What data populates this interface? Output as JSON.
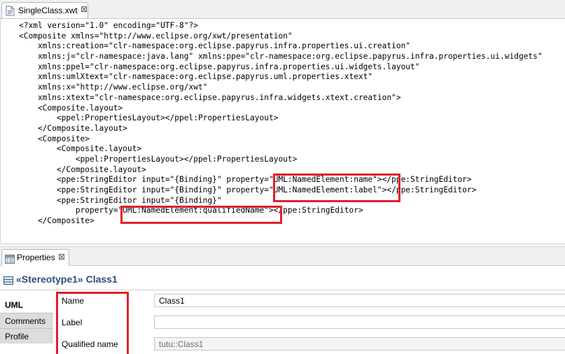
{
  "editor_tab": {
    "title": "SingleClass.xwt",
    "close": "⊠"
  },
  "code_lines": [
    "<?xml version=\"1.0\" encoding=\"UTF-8\"?>",
    "<Composite xmlns=\"http://www.eclipse.org/xwt/presentation\"",
    "    xmlns:creation=\"clr-namespace:org.eclipse.papyrus.infra.properties.ui.creation\"",
    "    xmlns:j=\"clr-namespace:java.lang\" xmlns:ppe=\"clr-namespace:org.eclipse.papyrus.infra.properties.ui.widgets\"",
    "    xmlns:ppel=\"clr-namespace:org.eclipse.papyrus.infra.properties.ui.widgets.layout\"",
    "    xmlns:umlXtext=\"clr-namespace:org.eclipse.papyrus.uml.properties.xtext\"",
    "    xmlns:x=\"http://www.eclipse.org/xwt\"",
    "    xmlns:xtext=\"clr-namespace:org.eclipse.papyrus.infra.widgets.xtext.creation\">",
    "    <Composite.layout>",
    "        <ppel:PropertiesLayout></ppel:PropertiesLayout>",
    "    </Composite.layout>",
    "    <Composite>",
    "        <Composite.layout>",
    "            <ppel:PropertiesLayout></ppel:PropertiesLayout>",
    "        </Composite.layout>",
    "        <ppe:StringEditor input=\"{Binding}\" property=\"UML:NamedElement:name\"></ppe:StringEditor>",
    "        <ppe:StringEditor input=\"{Binding}\" property=\"UML:NamedElement:label\"></ppe:StringEditor>",
    "        <ppe:StringEditor input=\"{Binding}\"",
    "            property=\"UML:NamedElement:qualifiedName\"></ppe:StringEditor>",
    "    </Composite>"
  ],
  "properties_tab": {
    "title": "Properties",
    "close": "⊠"
  },
  "element_header": {
    "title": "«Stereotype1» Class1"
  },
  "side_tabs": [
    {
      "label": "UML"
    },
    {
      "label": "Comments"
    },
    {
      "label": "Profile"
    }
  ],
  "form": {
    "fields": [
      {
        "label": "Name",
        "value": "Class1"
      },
      {
        "label": "Label",
        "value": ""
      },
      {
        "label": "Qualified name",
        "value": "tutu::Class1"
      }
    ]
  },
  "colors": {
    "highlight": "#e0202a",
    "header_text": "#2b4d7a"
  }
}
